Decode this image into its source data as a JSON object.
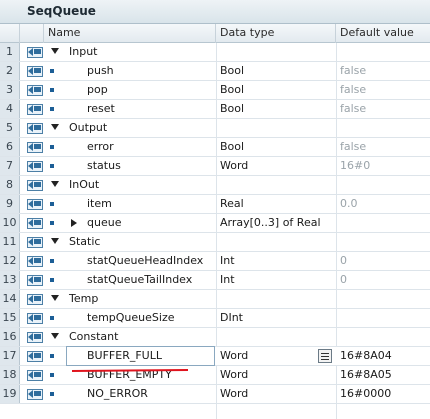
{
  "block": {
    "title": "SeqQueue"
  },
  "columns": {
    "name": "Name",
    "data_type": "Data type",
    "default_value": "Default value"
  },
  "rows": [
    {
      "num": "1",
      "name": "Input",
      "type": "",
      "default": "",
      "level": 0,
      "expander": "down",
      "dim": false
    },
    {
      "num": "2",
      "name": "push",
      "type": "Bool",
      "default": "false",
      "level": 1,
      "expander": "",
      "dim": true
    },
    {
      "num": "3",
      "name": "pop",
      "type": "Bool",
      "default": "false",
      "level": 1,
      "expander": "",
      "dim": true
    },
    {
      "num": "4",
      "name": "reset",
      "type": "Bool",
      "default": "false",
      "level": 1,
      "expander": "",
      "dim": true
    },
    {
      "num": "5",
      "name": "Output",
      "type": "",
      "default": "",
      "level": 0,
      "expander": "down",
      "dim": false
    },
    {
      "num": "6",
      "name": "error",
      "type": "Bool",
      "default": "false",
      "level": 1,
      "expander": "",
      "dim": true
    },
    {
      "num": "7",
      "name": "status",
      "type": "Word",
      "default": "16#0",
      "level": 1,
      "expander": "",
      "dim": true
    },
    {
      "num": "8",
      "name": "InOut",
      "type": "",
      "default": "",
      "level": 0,
      "expander": "down",
      "dim": false
    },
    {
      "num": "9",
      "name": "item",
      "type": "Real",
      "default": "0.0",
      "level": 1,
      "expander": "",
      "dim": true
    },
    {
      "num": "10",
      "name": "queue",
      "type": "Array[0..3] of Real",
      "default": "",
      "level": 1,
      "expander": "right",
      "dim": false
    },
    {
      "num": "11",
      "name": "Static",
      "type": "",
      "default": "",
      "level": 0,
      "expander": "down",
      "dim": false
    },
    {
      "num": "12",
      "name": "statQueueHeadIndex",
      "type": "Int",
      "default": "0",
      "level": 1,
      "expander": "",
      "dim": true
    },
    {
      "num": "13",
      "name": "statQueueTailIndex",
      "type": "Int",
      "default": "0",
      "level": 1,
      "expander": "",
      "dim": true
    },
    {
      "num": "14",
      "name": "Temp",
      "type": "",
      "default": "",
      "level": 0,
      "expander": "down",
      "dim": false
    },
    {
      "num": "15",
      "name": "tempQueueSize",
      "type": "DInt",
      "default": "",
      "level": 1,
      "expander": "",
      "dim": false
    },
    {
      "num": "16",
      "name": "Constant",
      "type": "",
      "default": "",
      "level": 0,
      "expander": "down",
      "dim": false
    },
    {
      "num": "17",
      "name": "BUFFER_FULL",
      "type": "Word",
      "default": "16#8A04",
      "level": 1,
      "expander": "",
      "dim": false,
      "selected": true
    },
    {
      "num": "18",
      "name": "BUFFER_EMPTY",
      "type": "Word",
      "default": "16#8A05",
      "level": 1,
      "expander": "",
      "dim": false
    },
    {
      "num": "19",
      "name": "NO_ERROR",
      "type": "Word",
      "default": "16#0000",
      "level": 1,
      "expander": "",
      "dim": false
    }
  ],
  "colors": {
    "annotation_underline": "#e0141e",
    "row_icon": "#2e6c9c",
    "dim_text": "#9aa3a9"
  }
}
